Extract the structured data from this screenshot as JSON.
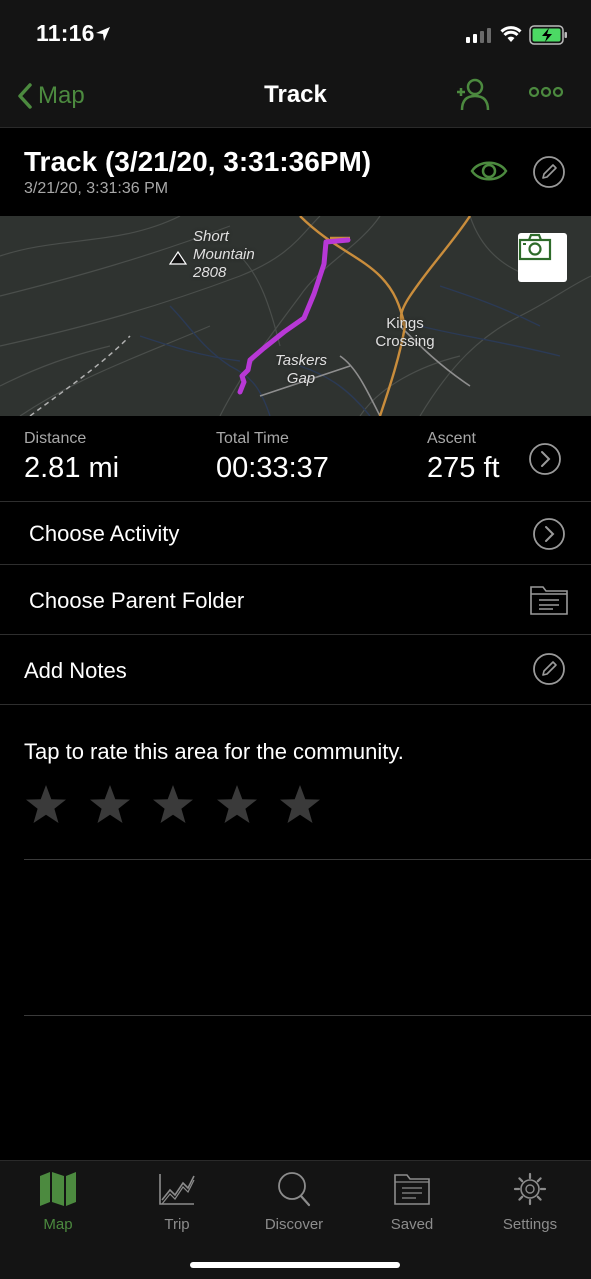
{
  "status_bar": {
    "time": "11:16"
  },
  "nav": {
    "back_label": "Map",
    "title": "Track"
  },
  "track": {
    "title": "Track (3/21/20, 3:31:36PM)",
    "subtitle": "3/21/20, 3:31:36 PM"
  },
  "map": {
    "peak_label_line1": "Short",
    "peak_label_line2": "Mountain",
    "peak_label_line3": "2808",
    "gap_label_line1": "Taskers",
    "gap_label_line2": "Gap",
    "town_label_line1": "Kings",
    "town_label_line2": "Crossing",
    "track_color": "#b838d6",
    "road_color": "#c98d3c"
  },
  "stats": {
    "distance_label": "Distance",
    "distance_value": "2.81 mi",
    "time_label": "Total Time",
    "time_value": "00:33:37",
    "ascent_label": "Ascent",
    "ascent_value": "275 ft"
  },
  "rows": {
    "activity": "Choose Activity",
    "folder": "Choose Parent Folder",
    "notes": "Add Notes"
  },
  "rating": {
    "prompt": "Tap to rate this area for the community.",
    "stars_total": 5,
    "stars_filled": 0
  },
  "tabs": [
    {
      "label": "Map",
      "icon": "map-icon",
      "active": true
    },
    {
      "label": "Trip",
      "icon": "chart-icon",
      "active": false
    },
    {
      "label": "Discover",
      "icon": "search-icon",
      "active": false
    },
    {
      "label": "Saved",
      "icon": "folder-icon",
      "active": false
    },
    {
      "label": "Settings",
      "icon": "gear-icon",
      "active": false
    }
  ],
  "colors": {
    "accent": "#4c8a3f",
    "background": "#000000",
    "bar": "#141414"
  }
}
